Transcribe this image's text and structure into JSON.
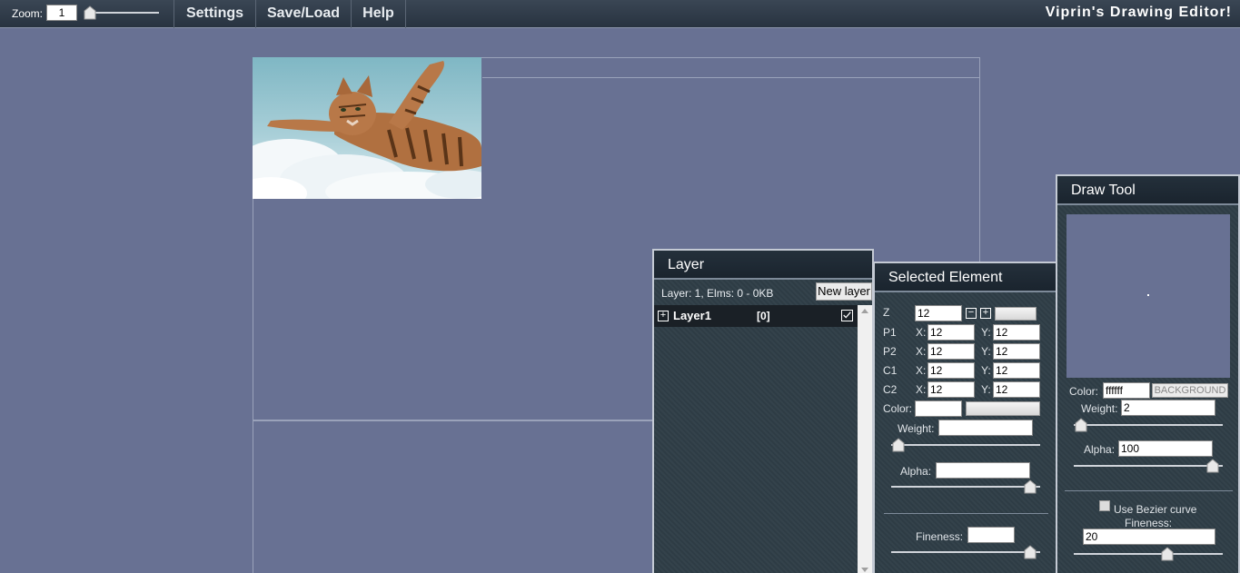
{
  "topbar": {
    "zoom_label": "Zoom:",
    "zoom_value": "1",
    "menu": {
      "settings": "Settings",
      "saveload": "Save/Load",
      "help": "Help"
    },
    "app_title": "Viprin's Drawing Editor!"
  },
  "layer_panel": {
    "title": "Layer",
    "info": "Layer: 1, Elms: 0 - 0KB",
    "new_layer_label": "New layer",
    "layers": [
      {
        "name": "Layer1",
        "count": "[0]",
        "visible": true
      }
    ]
  },
  "selected_element": {
    "title": "Selected Element",
    "z_label": "Z",
    "z_value": "12",
    "rows": [
      {
        "label": "P1",
        "x": "12",
        "y": "12"
      },
      {
        "label": "P2",
        "x": "12",
        "y": "12"
      },
      {
        "label": "C1",
        "x": "12",
        "y": "12"
      },
      {
        "label": "C2",
        "x": "12",
        "y": "12"
      }
    ],
    "x_label": "X:",
    "y_label": "Y:",
    "color_label": "Color:",
    "color_value": "",
    "weight_label": "Weight:",
    "weight_value": "",
    "alpha_label": "Alpha:",
    "alpha_value": "",
    "fineness_label": "Fineness:",
    "fineness_value": ""
  },
  "draw_tool": {
    "title": "Draw Tool",
    "color_label": "Color:",
    "color_value": "ffffff",
    "background_label": "BACKGROUND",
    "weight_label": "Weight:",
    "weight_value": "2",
    "alpha_label": "Alpha:",
    "alpha_value": "100",
    "bezier_label": "Use Bezier curve",
    "bezier_checked": false,
    "fineness_label": "Fineness:",
    "fineness_value": "20"
  },
  "colors": {
    "background": "#687193",
    "panel": "#2f3e47",
    "header": "#1a242e"
  }
}
